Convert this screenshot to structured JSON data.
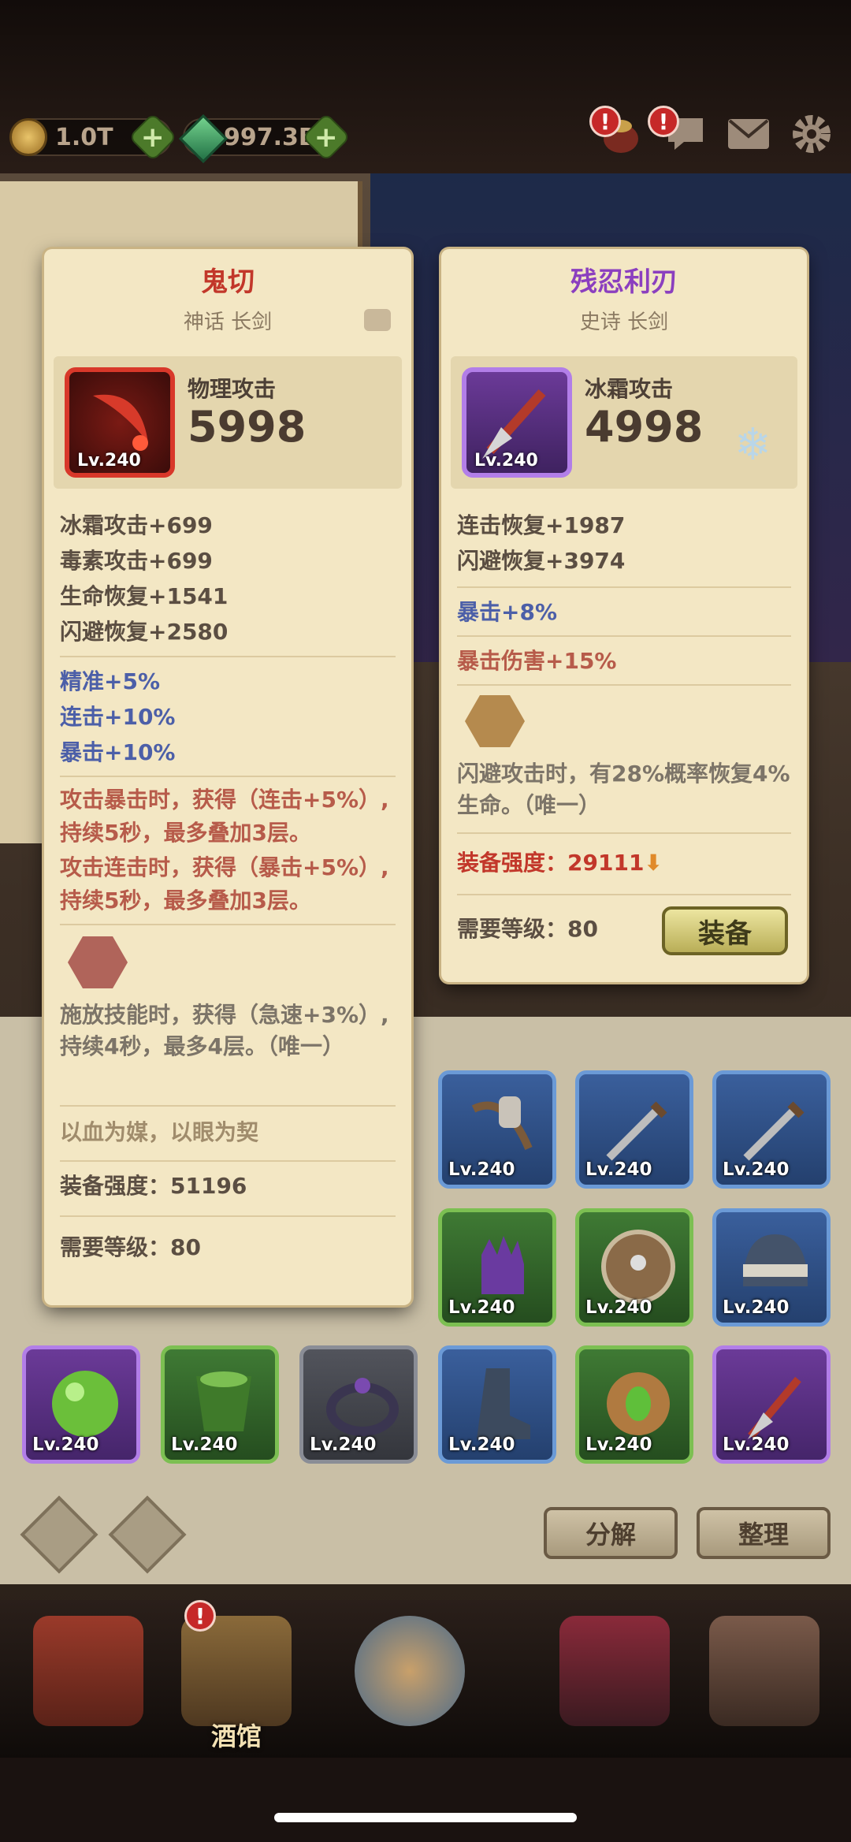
{
  "resources": {
    "gold": "1.0T",
    "gems": "997.3B",
    "alert_mark": "!"
  },
  "left_card": {
    "name": "鬼切",
    "name_color": "#c2372a",
    "subtitle": "神话 长剑",
    "main_stat_name": "物理攻击",
    "main_stat_value": "5998",
    "item_level": "Lv.240",
    "base_stats": [
      "冰霜攻击+699",
      "毒素攻击+699",
      "生命恢复+1541",
      "闪避恢复+2580"
    ],
    "blue_stats": [
      "精准+5%",
      "连击+10%",
      "暴击+10%"
    ],
    "effect_1": "攻击暴击时，获得（连击+5%）, 持续5秒，最多叠加3层。",
    "effect_2": "攻击连击时，获得（暴击+5%）, 持续5秒，最多叠加3层。",
    "gem_color": "#b0645a",
    "skill": "施放技能时，获得（急速+3%）, 持续4秒，最多4层。（唯一）",
    "flavor": "以血为媒，以眼为契",
    "power": "装备强度：51196",
    "required_level": "需要等级：80"
  },
  "right_card": {
    "name": "残忍利刃",
    "name_color": "#8b3fbf",
    "subtitle": "史诗 长剑",
    "main_stat_name": "冰霜攻击",
    "main_stat_value": "4998",
    "item_level": "Lv.240",
    "base_stats": [
      "连击恢复+1987",
      "闪避恢复+3974"
    ],
    "blue_stats": [
      "暴击+8%"
    ],
    "red_stats": [
      "暴击伤害+15%"
    ],
    "gem_color": "#b58a4e",
    "skill": "闪避攻击时，有28%概率恢复4%生命。（唯一）",
    "power_label": "装备强度：",
    "power_value": "29111",
    "required_level": "需要等级：80",
    "equip_label": "装备"
  },
  "inventory": {
    "row1": [
      {
        "level": "Lv.240",
        "rarity": "blue",
        "icon": "crossbow-icon"
      },
      {
        "level": "Lv.240",
        "rarity": "blue",
        "icon": "dagger-icon"
      },
      {
        "level": "Lv.240",
        "rarity": "blue",
        "icon": "dagger-icon"
      }
    ],
    "row2": [
      {
        "level": "Lv.240",
        "rarity": "green",
        "icon": "glove-icon"
      },
      {
        "level": "Lv.240",
        "rarity": "green",
        "icon": "shield-icon"
      },
      {
        "level": "Lv.240",
        "rarity": "blue",
        "icon": "helmet-icon"
      }
    ],
    "row3": [
      {
        "level": "Lv.240",
        "rarity": "purple",
        "icon": "orb-icon"
      },
      {
        "level": "Lv.240",
        "rarity": "green",
        "icon": "armor-icon"
      },
      {
        "level": "Lv.240",
        "rarity": "gray",
        "icon": "ring-icon"
      },
      {
        "level": "Lv.240",
        "rarity": "blue",
        "icon": "boots-icon"
      },
      {
        "level": "Lv.240",
        "rarity": "green",
        "icon": "amulet-icon"
      },
      {
        "level": "Lv.240",
        "rarity": "purple",
        "icon": "dagger-icon"
      }
    ],
    "decompose_label": "分解",
    "sort_label": "整理"
  },
  "nav": {
    "tavern_label": "酒馆"
  }
}
